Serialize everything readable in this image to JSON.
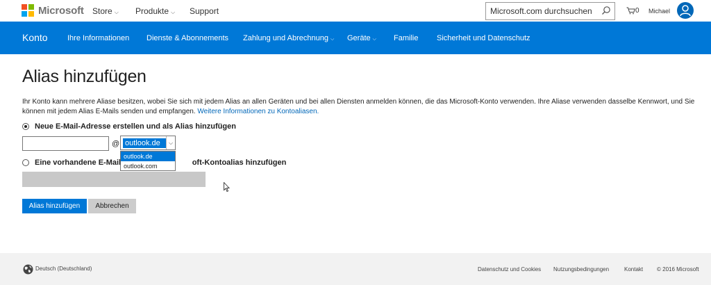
{
  "header": {
    "brand": "Microsoft",
    "nav": [
      {
        "label": "Store",
        "has_menu": true
      },
      {
        "label": "Produkte",
        "has_menu": true
      },
      {
        "label": "Support",
        "has_menu": false
      }
    ],
    "search_value": "Microsoft.com durchsuchen",
    "cart_count": "0",
    "user_name": "Michael"
  },
  "account_nav": {
    "title": "Konto",
    "items": [
      {
        "label": "Ihre Informationen",
        "has_menu": false
      },
      {
        "label": "Dienste & Abonnements",
        "has_menu": false
      },
      {
        "label": "Zahlung und Abrechnung",
        "has_menu": true
      },
      {
        "label": "Geräte",
        "has_menu": true
      },
      {
        "label": "Familie",
        "has_menu": false
      },
      {
        "label": "Sicherheit und Datenschutz",
        "has_menu": false
      }
    ]
  },
  "main": {
    "title": "Alias hinzufügen",
    "intro_text": "Ihr Konto kann mehrere Aliase besitzen, wobei Sie sich mit jedem Alias an allen Geräten und bei allen Diensten anmelden können, die das Microsoft-Konto verwenden. Ihre Aliase verwenden dasselbe Kennwort, und Sie können mit jedem Alias E-Mails senden und empfangen. ",
    "intro_link": "Weitere Informationen zu Kontoaliasen.",
    "option_new": "Neue E-Mail-Adresse erstellen und als Alias hinzufügen",
    "option_new_selected": true,
    "at_sign": "@",
    "domain_selected": "outlook.de",
    "domain_options": [
      "outlook.de",
      "outlook.com"
    ],
    "option_existing_left": "Eine vorhandene E-Mail-A",
    "option_existing_right": "oft-Kontoalias hinzufügen",
    "add_button": "Alias hinzufügen",
    "cancel_button": "Abbrechen"
  },
  "footer": {
    "locale": "Deutsch (Deutschland)",
    "links": [
      "Datenschutz und Cookies",
      "Nutzungsbedingungen",
      "Kontakt"
    ],
    "copyright": "© 2016 Microsoft"
  },
  "colors": {
    "accent": "#0078d7",
    "link": "#0067b8",
    "footer_bg": "#f2f2f2"
  }
}
